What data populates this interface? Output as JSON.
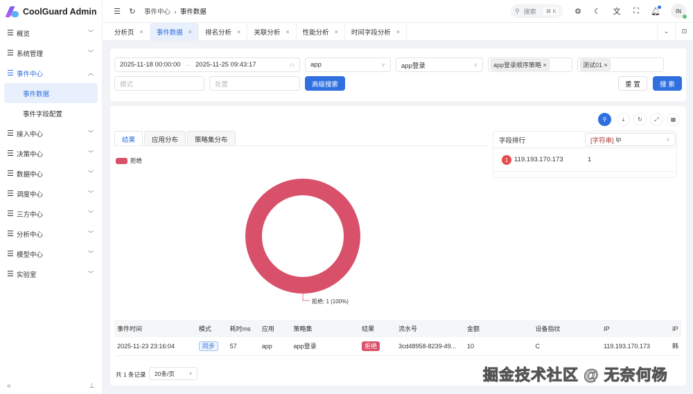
{
  "app": {
    "title": "CoolGuard Admin"
  },
  "sidebar": {
    "items": [
      {
        "label": "概览",
        "open": false
      },
      {
        "label": "系统管理",
        "open": false
      },
      {
        "label": "事件中心",
        "open": true,
        "children": [
          {
            "label": "事件数据",
            "active": true
          },
          {
            "label": "事件字段配置",
            "active": false
          }
        ]
      },
      {
        "label": "接入中心",
        "open": false
      },
      {
        "label": "决策中心",
        "open": false
      },
      {
        "label": "数据中心",
        "open": false
      },
      {
        "label": "调度中心",
        "open": false
      },
      {
        "label": "三方中心",
        "open": false
      },
      {
        "label": "分析中心",
        "open": false
      },
      {
        "label": "模型中心",
        "open": false
      },
      {
        "label": "实验室",
        "open": false
      }
    ]
  },
  "header": {
    "breadcrumb": [
      "事件中心",
      "事件数据"
    ],
    "search_placeholder": "搜索",
    "search_shortcut": "⌘ K",
    "avatar": "IN"
  },
  "tabs": [
    {
      "label": "分析页"
    },
    {
      "label": "事件数据",
      "active": true
    },
    {
      "label": "排名分析"
    },
    {
      "label": "关联分析"
    },
    {
      "label": "性能分析"
    },
    {
      "label": "时间字段分析"
    }
  ],
  "filters": {
    "start_time": "2025-11-18 00:00:00",
    "end_time": "2025-11-25 09:43:17",
    "app": "app",
    "policy_set": "app登录",
    "policy_tag": "app登录顺序策略",
    "rule_tag": "测试01",
    "mode_placeholder": "模式",
    "disposal_placeholder": "处置",
    "advanced_label": "高级搜索",
    "reset_label": "重 置",
    "search_label": "搜 索"
  },
  "result_tabs": [
    {
      "label": "结果",
      "active": true
    },
    {
      "label": "应用分布"
    },
    {
      "label": "策略集分布"
    }
  ],
  "chart_data": {
    "type": "pie",
    "donut": true,
    "legend": [
      "拒绝"
    ],
    "legend_placement": "top-left",
    "slices": [
      {
        "name": "拒绝",
        "value": 1,
        "percent": 100,
        "color": "#d9506a"
      }
    ],
    "label": "拒绝: 1 (100%)"
  },
  "ranking": {
    "title": "字段排行",
    "field_type": "[字符串]",
    "field": "ip",
    "rows": [
      {
        "rank": "1",
        "value": "119.193.170.173",
        "count": "1"
      }
    ]
  },
  "table": {
    "columns": [
      "事件时间",
      "模式",
      "耗时ms",
      "应用",
      "策略集",
      "结果",
      "流水号",
      "金额",
      "设备指纹",
      "IP",
      "IP"
    ],
    "rows": [
      [
        "2025-11-23 23:16:04",
        "同步",
        "57",
        "app",
        "app登录",
        "拒绝",
        "3cd48958-8239-49...",
        "10",
        "C",
        "119.193.170.173",
        "韩"
      ]
    ]
  },
  "pagination": {
    "total": "共 1 条记录",
    "page_size": "20条/页"
  },
  "watermark": "掘金技术社区 @ 无奈何杨",
  "colors": {
    "accent": "#2f6fe0",
    "reject": "#d9506a"
  }
}
